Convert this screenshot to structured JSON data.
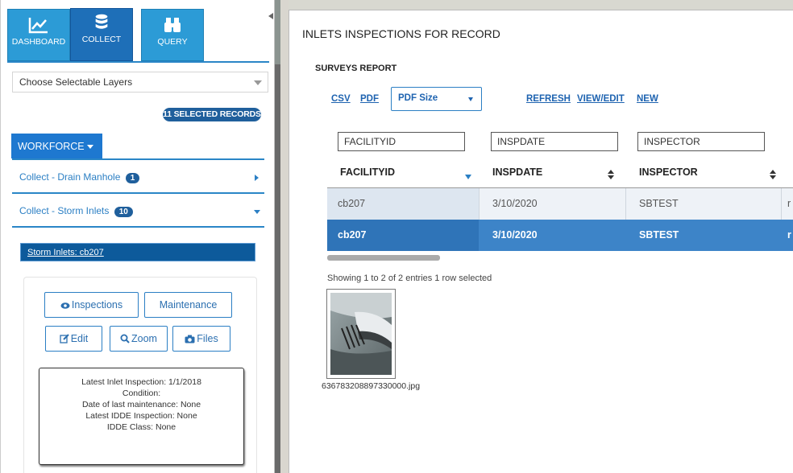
{
  "nav_tabs": [
    {
      "label": "DASHBOARD",
      "icon": "line-chart-icon",
      "active": false
    },
    {
      "label": "COLLECT",
      "icon": "database-icon",
      "active": true
    },
    {
      "label": "QUERY",
      "icon": "binoculars-icon",
      "active": false
    }
  ],
  "layer_select": {
    "value": "Choose Selectable Layers"
  },
  "selected_badge": "11 SELECTED RECORDS",
  "workforce_label": "WORKFORCE",
  "collect_items": [
    {
      "label": "Collect - Drain Manhole",
      "count": "1"
    },
    {
      "label": "Collect - Storm Inlets",
      "count": "10"
    }
  ],
  "storm_link": "Storm Inlets: cb207",
  "card_buttons": {
    "inspections": "Inspections",
    "maintenance": "Maintenance",
    "edit": "Edit",
    "zoom": "Zoom",
    "files": "Files"
  },
  "info": {
    "latest_inlet_inspection": "Latest Inlet Inspection: 1/1/2018",
    "condition": "Condition:",
    "last_maintenance": "Date of last maintenance: None",
    "latest_idde": "Latest IDDE Inspection: None",
    "idde_class": "IDDE Class: None"
  },
  "dialog": {
    "title": "INLETS INSPECTIONS FOR RECORD",
    "subtitle": "SURVEYS REPORT",
    "links": {
      "csv": "CSV",
      "pdf": "PDF",
      "refresh": "REFRESH",
      "view_edit": "VIEW/EDIT",
      "new": "NEW"
    },
    "pdf_size": "PDF Size",
    "filters": [
      "FACILITYID",
      "INSPDATE",
      "INSPECTOR"
    ],
    "columns": [
      "FACILITYID",
      "INSPDATE",
      "INSPECTOR"
    ],
    "rows": [
      {
        "facilityid": "cb207",
        "inspdate": "3/10/2020",
        "inspector": "SBTEST",
        "more": "r"
      },
      {
        "facilityid": "cb207",
        "inspdate": "3/10/2020",
        "inspector": "SBTEST",
        "more": "r"
      }
    ],
    "showing": "Showing 1 to 2 of 2 entries   1 row selected",
    "attachment_name": "636783208897330000.jpg"
  }
}
